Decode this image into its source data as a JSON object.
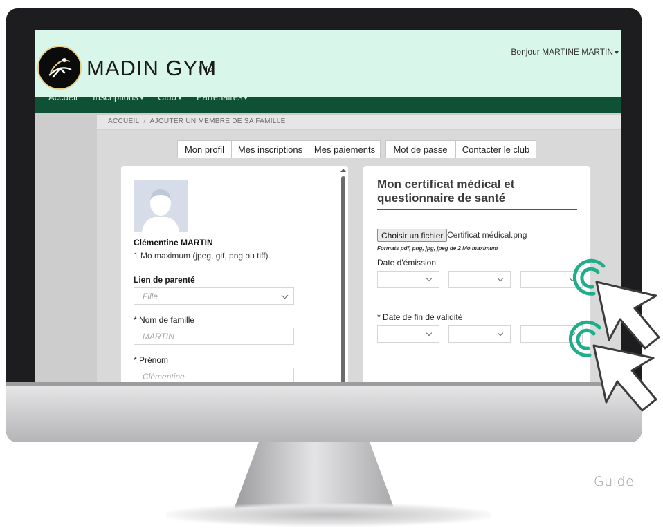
{
  "header": {
    "brand": "MADIN GYM",
    "social_facebook": "f",
    "greeting": "Bonjour MARTINE MARTIN"
  },
  "nav": {
    "items": [
      "Accueil",
      "Inscriptions",
      "Club",
      "Partenaires"
    ]
  },
  "breadcrumb": {
    "home": "ACCUEIL",
    "separator": "/",
    "current": "AJOUTER UN MEMBRE DE SA FAMILLE"
  },
  "tabs": [
    "Mon profil",
    "Mes inscriptions",
    "Mes paiements",
    "Mot de passe",
    "Contacter le club"
  ],
  "member": {
    "name": "Clémentine MARTIN",
    "photo_hint": "1 Mo maximum (jpeg, gif, png ou tiff)",
    "relation_label": "Lien de parenté",
    "relation_value": "Fille",
    "lastname_label": "* Nom de famille",
    "lastname_value": "MARTIN",
    "firstname_label": "* Prénom",
    "firstname_value": "Clémentine"
  },
  "certificate": {
    "title": "Mon certificat médical et questionnaire de santé",
    "choose_file": "Choisir un fichier",
    "file_name": "Certificat médical.png",
    "formats": "Formats pdf, png, jpg, jpeg de 2 Mo maximum",
    "issue_date_label": "Date d'émission",
    "end_date_label": "* Date de fin de validité"
  },
  "footer_label": "Guide",
  "colors": {
    "header_bg": "#d8f6ea",
    "nav_bg": "#0f5134",
    "accent_teal": "#1fae8c"
  },
  "icons": [
    "facebook-icon",
    "instagram-icon",
    "chevron-down-icon",
    "user-silhouette-icon",
    "cursor-arrow-icon"
  ]
}
